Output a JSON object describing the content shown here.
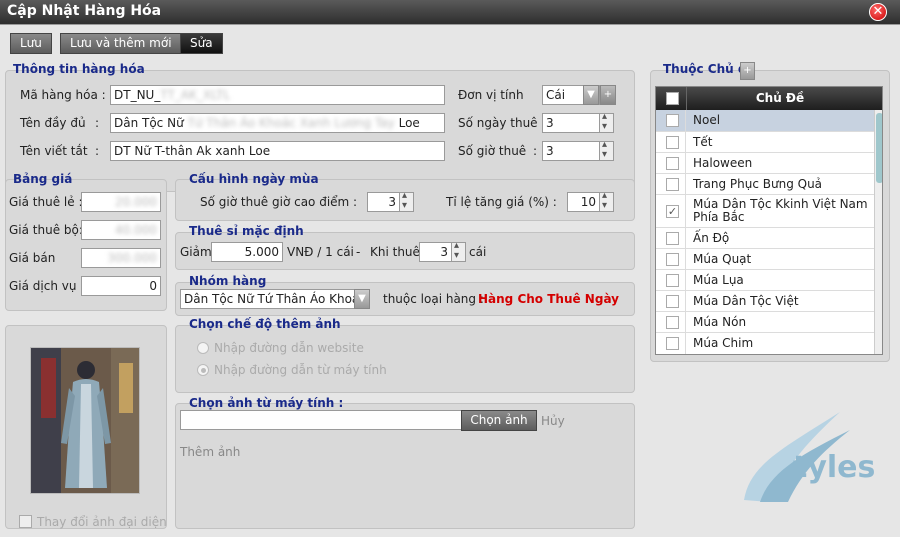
{
  "window": {
    "title": "Cập Nhật Hàng Hóa"
  },
  "toolbar": {
    "save": "Lưu",
    "save_new": "Lưu và thêm mới",
    "edit": "Sửa"
  },
  "product_info": {
    "title": "Thông tin hàng hóa",
    "code_label": "Mã hàng hóa :",
    "code_value": "DT_NU_",
    "code_value_blur": "TT_AK_XLTL",
    "fullname_label": "Tên đầy đủ",
    "fullname_prefix": "Dân Tộc Nữ",
    "fullname_blur": "Tứ Thân Áo Khoác Xanh Lương Tay",
    "fullname_suffix": "Loe",
    "shortname_label": "Tên viết tắt",
    "shortname_value": "DT Nữ T-thân Ak xanh Loe",
    "unit_label": "Đơn vị tính",
    "unit_value": "Cái",
    "days_label": "Số ngày thuê :",
    "days_value": "3",
    "hours_label": "Số giờ thuê",
    "hours_value": "3"
  },
  "price_table": {
    "title": "Bảng giá",
    "retail_label": "Giá thuê lẻ :",
    "retail_blur": "20.000",
    "set_label": "Giá thuê bộ:",
    "set_blur": "40.000",
    "sale_label": "Giá bán",
    "sale_blur": "300.000",
    "service_label": "Giá dịch vụ :",
    "service_value": "0"
  },
  "peak_config": {
    "title": "Cấu hình ngày mùa",
    "peak_hours_label": "Số giờ thuê giờ cao điểm :",
    "peak_hours_value": "3",
    "increase_label": "Tỉ lệ tăng giá (%) :",
    "increase_value": "10"
  },
  "wholesale": {
    "title": "Thuê sỉ mặc định",
    "discount_label": "Giảm",
    "discount_value": "5.000",
    "unit_text": "VNĐ / 1 cái",
    "dash": "-",
    "when_label": "Khi thuê",
    "qty_value": "3",
    "qty_unit": "cái"
  },
  "group": {
    "title": "Nhóm hàng",
    "selected": "Dân Tộc Nữ Tứ Thân Áo Khoác",
    "type_label": "thuộc loại hàng :",
    "type_value": "Hàng Cho Thuê Ngày"
  },
  "image_mode": {
    "title": "Chọn chế độ thêm ảnh",
    "option_website": "Nhập đường dẫn website",
    "option_computer": "Nhập đường dẫn từ máy tính"
  },
  "image_pick": {
    "title": "Chọn ảnh từ máy tính :",
    "choose": "Chọn ảnh",
    "cancel": "Hủy",
    "add": "Thêm ảnh"
  },
  "avatar": {
    "change_label": "Thay đổi ảnh đại diện"
  },
  "topics": {
    "title": "Thuộc Chủ đề",
    "column": "Chủ Đề",
    "items": [
      {
        "label": "Noel"
      },
      {
        "label": "Tết"
      },
      {
        "label": "Haloween"
      },
      {
        "label": "Trang Phục Bưng Quả"
      },
      {
        "label": "Múa Dân Tộc Kkinh Việt Nam Phía Bắc"
      },
      {
        "label": "Ấn Độ"
      },
      {
        "label": "Múa Quạt"
      },
      {
        "label": "Múa Lụa"
      },
      {
        "label": "Múa Dân Tộc Việt"
      },
      {
        "label": "Múa Nón"
      },
      {
        "label": "Múa Chim"
      }
    ]
  },
  "logo": {
    "text": "tyles"
  },
  "colors": {
    "accent_blue": "#1a2a8a",
    "alert_red": "#d40000",
    "logo_teal": "#8fb8cf"
  }
}
